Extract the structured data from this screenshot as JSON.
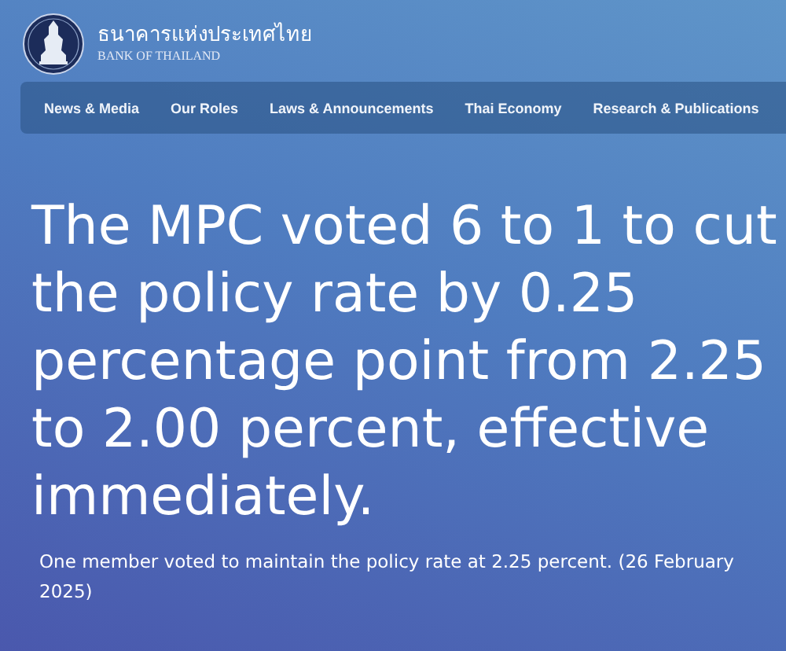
{
  "header": {
    "name_thai": "ธนาคารแห่งประเทศไทย",
    "name_english": "BANK OF THAILAND"
  },
  "nav": [
    {
      "label": "News & Media"
    },
    {
      "label": "Our Roles"
    },
    {
      "label": "Laws & Announcements"
    },
    {
      "label": "Thai Economy"
    },
    {
      "label": "Research & Publications"
    }
  ],
  "headline": "The MPC voted 6 to 1 to cut the policy rate by 0.25 percentage point from 2.25 to 2.00 percent, effective immediately.",
  "subtext": "One member voted to maintain the policy rate at 2.25 percent. (26 February 2025)"
}
